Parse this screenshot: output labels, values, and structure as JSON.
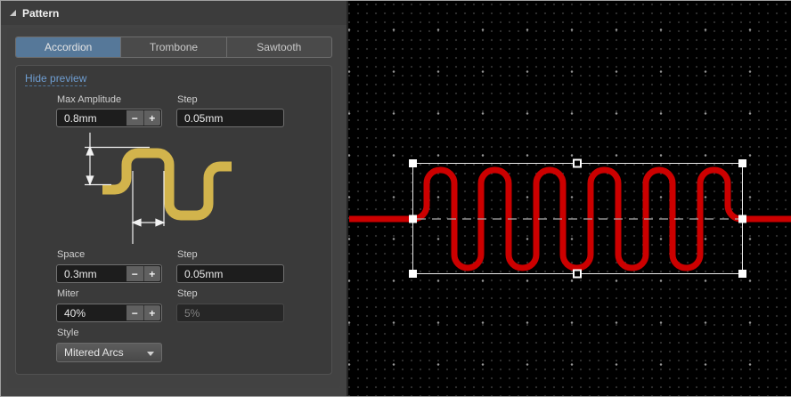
{
  "panel": {
    "title": "Pattern",
    "tabs": [
      {
        "label": "Accordion",
        "selected": true
      },
      {
        "label": "Trombone",
        "selected": false
      },
      {
        "label": "Sawtooth",
        "selected": false
      }
    ],
    "preview_link": "Hide preview",
    "fields": {
      "max_amplitude": {
        "label": "Max Amplitude",
        "value": "0.8mm"
      },
      "max_amplitude_step": {
        "label": "Step",
        "value": "0.05mm"
      },
      "space": {
        "label": "Space",
        "value": "0.3mm"
      },
      "space_step": {
        "label": "Step",
        "value": "0.05mm"
      },
      "miter": {
        "label": "Miter",
        "value": "40%"
      },
      "miter_step": {
        "label": "Step",
        "value": "5%",
        "disabled": true
      },
      "style": {
        "label": "Style",
        "value": "Mitered Arcs"
      }
    },
    "stepper": {
      "decrease": "−",
      "increase": "+"
    }
  },
  "colors": {
    "accent_tab_blue": "#567899",
    "link_blue": "#6f9ed2",
    "preview_trace_yellow": "#d2b44c",
    "pcb_trace_red": "#cc0000",
    "selection_white": "#eaeaea"
  }
}
